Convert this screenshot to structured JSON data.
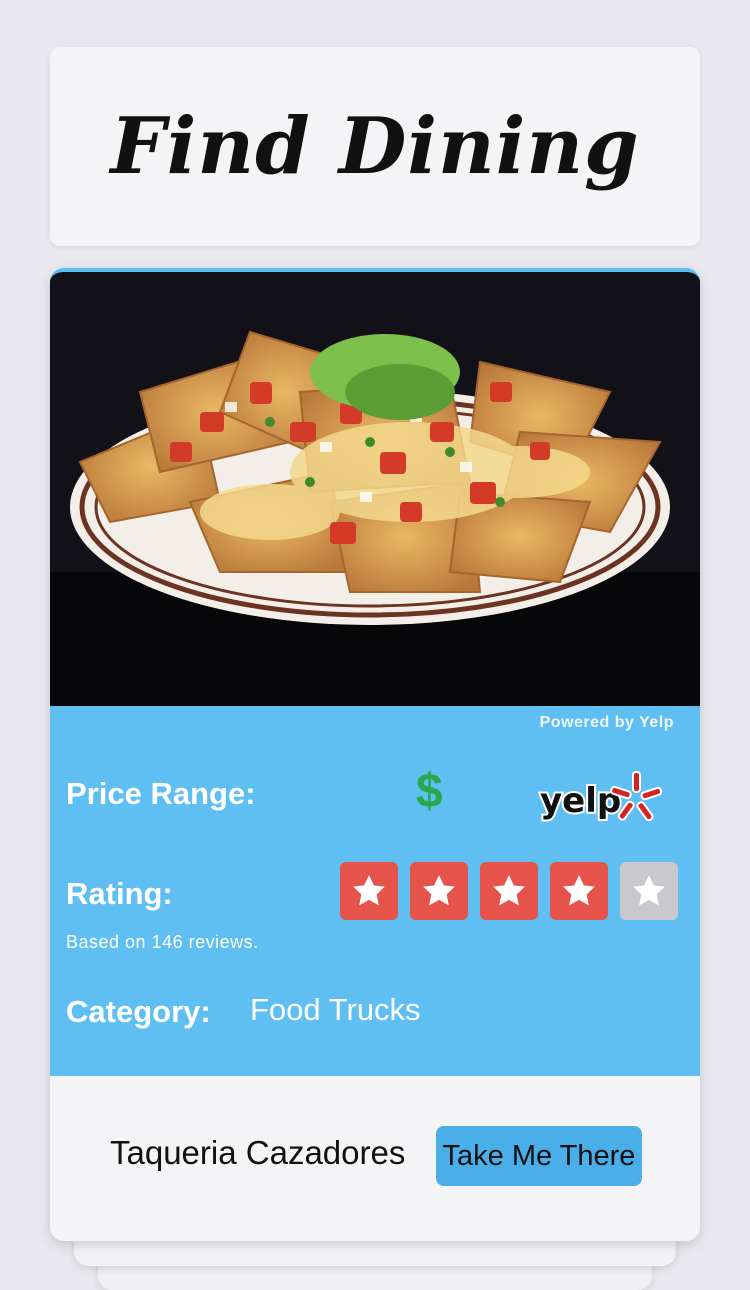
{
  "header": {
    "title": "Find Dining"
  },
  "restaurant": {
    "image_alt": "Nachos with guacamole and pico de gallo",
    "powered_by": "Powered by Yelp",
    "price_label": "Price Range:",
    "price_value": "$",
    "rating_label": "Rating:",
    "rating": 4,
    "rating_max": 5,
    "reviews_text": "Based on 146 reviews.",
    "category_label": "Category:",
    "category_value": "Food Trucks",
    "name": "Taqueria Cazadores",
    "action_label": "Take Me There",
    "yelp_logo_text": "yelp"
  },
  "colors": {
    "accent": "#5fbff2",
    "button": "#4aaee9",
    "price": "#27a84a",
    "star_on": "#e5534b",
    "star_off": "#c9c9cd"
  }
}
